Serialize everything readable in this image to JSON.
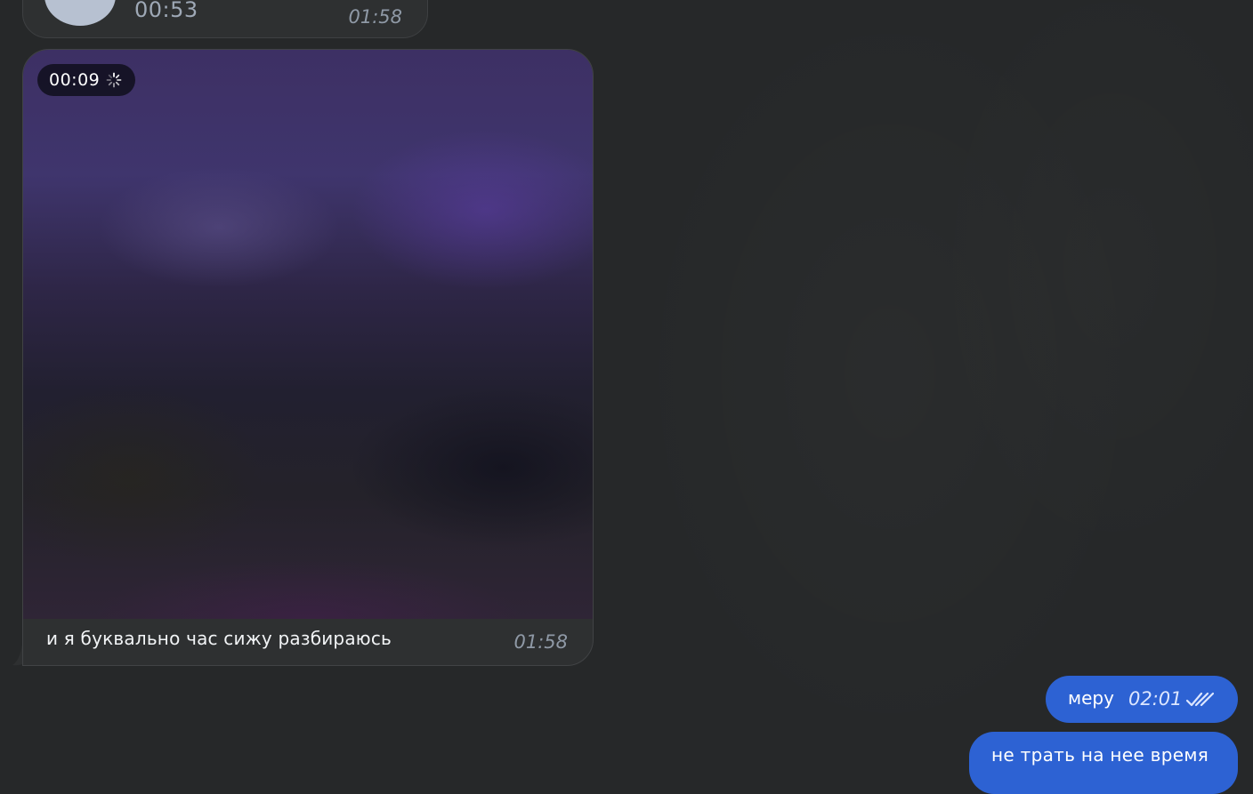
{
  "messages": {
    "voice": {
      "duration": "00:53",
      "time": "01:58"
    },
    "video": {
      "duration": "00:09",
      "caption": "и я буквально час сижу разбираюсь",
      "time": "01:58"
    },
    "outgoing": [
      {
        "text": "меру",
        "time": "02:01",
        "status_icon": "double-check-icon"
      },
      {
        "text": "не трать на нее время"
      }
    ]
  },
  "colors": {
    "background": "#262829",
    "incoming_bubble": "#2e3031",
    "outgoing_bubble": "#2d62d3",
    "timestamp": "#8f99a6"
  }
}
